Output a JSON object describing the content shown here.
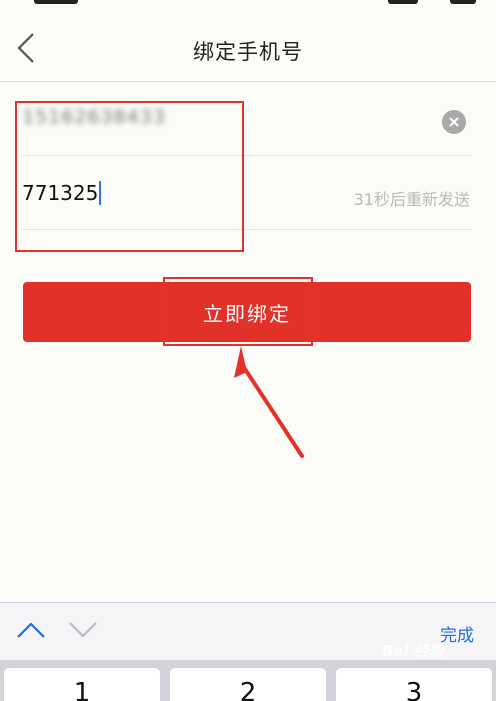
{
  "nav": {
    "title": "绑定手机号",
    "back_icon": "chevron-left-icon"
  },
  "form": {
    "phone_value": "15162638433",
    "clear_icon": "clear-icon",
    "code_value": "771325",
    "resend_text": "31秒后重新发送"
  },
  "submit": {
    "label": "立即绑定"
  },
  "keyboard_toolbar": {
    "up_icon": "chevron-up-icon",
    "down_icon": "chevron-down-icon",
    "done_label": "完成"
  },
  "keypad": {
    "keys": [
      "1",
      "2",
      "3"
    ]
  },
  "watermark": {
    "text": "Bai 经验"
  },
  "colors": {
    "accent_red": "#e23129",
    "annotation_red": "#e3322d",
    "link_blue": "#1f6fe0"
  }
}
